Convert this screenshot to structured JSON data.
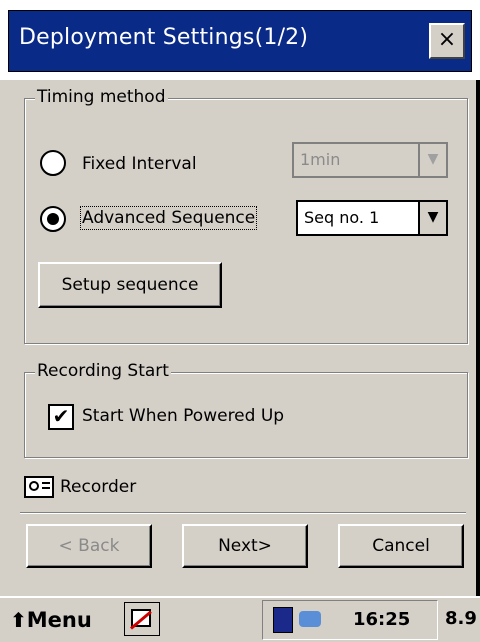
{
  "window": {
    "title": "Deployment Settings(1/2)",
    "close_label": "×"
  },
  "timing": {
    "group_label": "Timing method",
    "fixed": {
      "label": "Fixed Interval",
      "selected": false,
      "interval_value": "1min",
      "enabled": false
    },
    "advanced": {
      "label": "Advanced Sequence",
      "selected": true,
      "sequence_value": "Seq no. 1"
    },
    "setup_button": "Setup sequence"
  },
  "recording": {
    "group_label": "Recording Start",
    "start_powered_up": {
      "label": "Start When Powered Up",
      "checked": true,
      "check_glyph": "✔"
    }
  },
  "recorder": {
    "label": "Recorder"
  },
  "buttons": {
    "back": "< Back",
    "next": "Next>",
    "cancel": "Cancel"
  },
  "taskbar": {
    "menu_label": "Menu",
    "time": "16:25",
    "zoom": "8.9"
  },
  "colors": {
    "title_bg": "#0a2a87",
    "face": "#d4d0c8"
  }
}
